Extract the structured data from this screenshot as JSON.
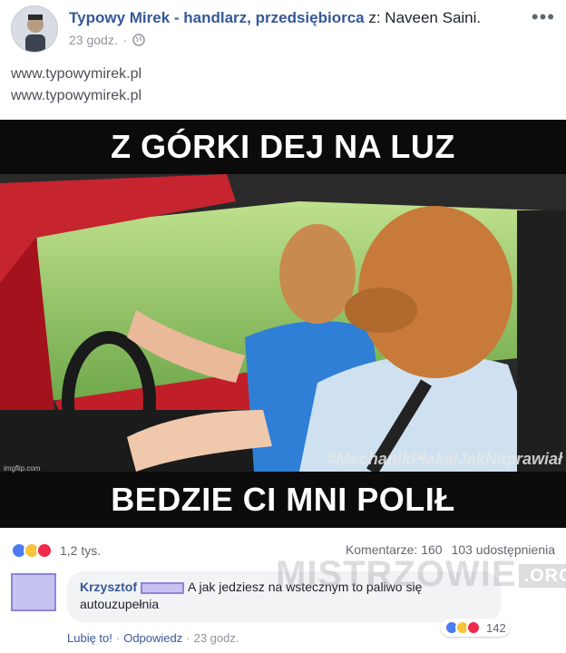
{
  "post": {
    "page_name": "Typowy Mirek - handlarz, przedsiębiorca",
    "with_text": "z: Naveen Saini.",
    "time": "23 godz.",
    "separator": "·",
    "more": "•••",
    "text_lines": [
      "www.typowymirek.pl",
      "www.typowymirek.pl"
    ]
  },
  "meme": {
    "top_caption": "Z GÓRKI DEJ NA LUZ",
    "bottom_caption": "BEDZIE CI MNI POLIŁ",
    "hashtag": "#MechanikPłakałJakNaprawiał",
    "small_watermark": "imgflip.com"
  },
  "stats": {
    "reaction_count": "1,2 tys.",
    "comments": "Komentarze: 160",
    "shares": "103 udostępnienia"
  },
  "comment": {
    "author": "Krzysztof",
    "text": "A jak jedziesz na wstecznym to paliwo się autouzupełnia",
    "reaction_count": "142",
    "like_label": "Lubię to!",
    "reply_label": "Odpowiedz",
    "time": "23 godz.",
    "sep": "·",
    "watermark": "MISTRZOWIE",
    "watermark_tld": ".ORG"
  },
  "colors": {
    "link": "#365899",
    "like": "#4a7bf1",
    "haha": "#f7c33b",
    "love": "#f0284a",
    "redaction": "#c6c3f0"
  }
}
